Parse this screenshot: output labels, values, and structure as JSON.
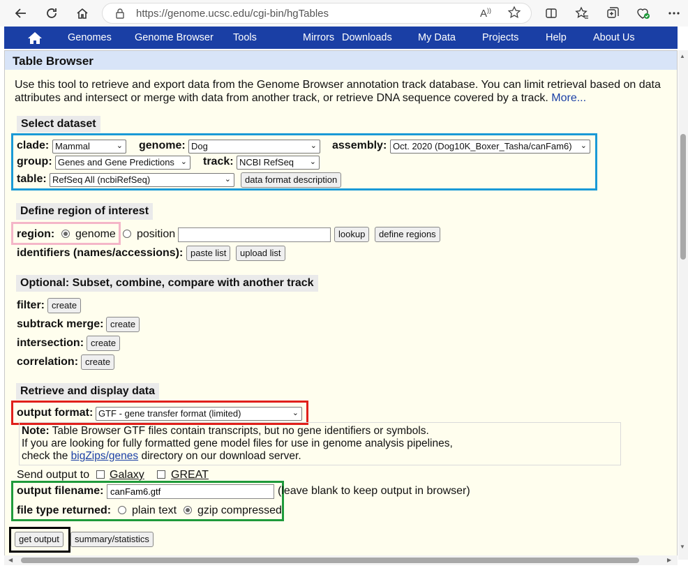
{
  "browser": {
    "url": "https://genome.ucsc.edu/cgi-bin/hgTables"
  },
  "nav": {
    "home_icon": "home-icon",
    "items": [
      "Genomes",
      "Genome Browser",
      "Tools",
      "Mirrors",
      "Downloads",
      "My Data",
      "Projects",
      "Help",
      "About Us"
    ]
  },
  "page": {
    "title": "Table Browser",
    "intro": "Use this tool to retrieve and export data from the Genome Browser annotation track database. You can limit retrieval based on data attributes and intersect or merge with data from another track, or retrieve DNA sequence covered by a track.",
    "more_link": "More..."
  },
  "dataset": {
    "heading": "Select dataset",
    "clade_label": "clade:",
    "clade_value": "Mammal",
    "genome_label": "genome:",
    "genome_value": "Dog",
    "assembly_label": "assembly:",
    "assembly_value": "Oct. 2020 (Dog10K_Boxer_Tasha/canFam6)",
    "group_label": "group:",
    "group_value": "Genes and Gene Predictions",
    "track_label": "track:",
    "track_value": "NCBI RefSeq",
    "table_label": "table:",
    "table_value": "RefSeq All (ncbiRefSeq)",
    "describe_button": "data format description"
  },
  "region": {
    "heading": "Define region of interest",
    "region_label": "region:",
    "opt_genome": "genome",
    "opt_position": "position",
    "position_value": "",
    "lookup_button": "lookup",
    "define_button": "define regions",
    "identifiers_label": "identifiers (names/accessions):",
    "paste_button": "paste list",
    "upload_button": "upload list"
  },
  "optional": {
    "heading": "Optional: Subset, combine, compare with another track",
    "filter_label": "filter:",
    "subtrack_label": "subtrack merge:",
    "intersection_label": "intersection:",
    "correlation_label": "correlation:",
    "create_label": "create"
  },
  "retrieve": {
    "heading": "Retrieve and display data",
    "format_label": "output format:",
    "format_value": "GTF - gene transfer format (limited)",
    "note_bold": "Note:",
    "note_line1": " Table Browser GTF files contain transcripts, but no gene identifiers or symbols.",
    "note_line2": "If you are looking for fully formatted gene model files for use in genome analysis pipelines,",
    "note_line3_pre": "check the ",
    "note_link": "bigZips/genes",
    "note_line3_post": " directory on our download server.",
    "send_label": "Send output to",
    "galaxy": "Galaxy",
    "great": "GREAT",
    "filename_label": "output filename:",
    "filename_value": "canFam6.gtf",
    "filename_hint": "(leave blank to keep output in browser)",
    "filetype_label": "file type returned:",
    "plain_text": "plain text",
    "gzip": "gzip compressed",
    "get_output": "get output",
    "summary": "summary/statistics"
  },
  "colors": {
    "nav_bg": "#1a3fa5",
    "highlight_blue": "#1a9ad6",
    "highlight_pink": "#f4b6c8",
    "highlight_red": "#e0201b",
    "highlight_green": "#1f9a3b",
    "highlight_black": "#000000"
  }
}
